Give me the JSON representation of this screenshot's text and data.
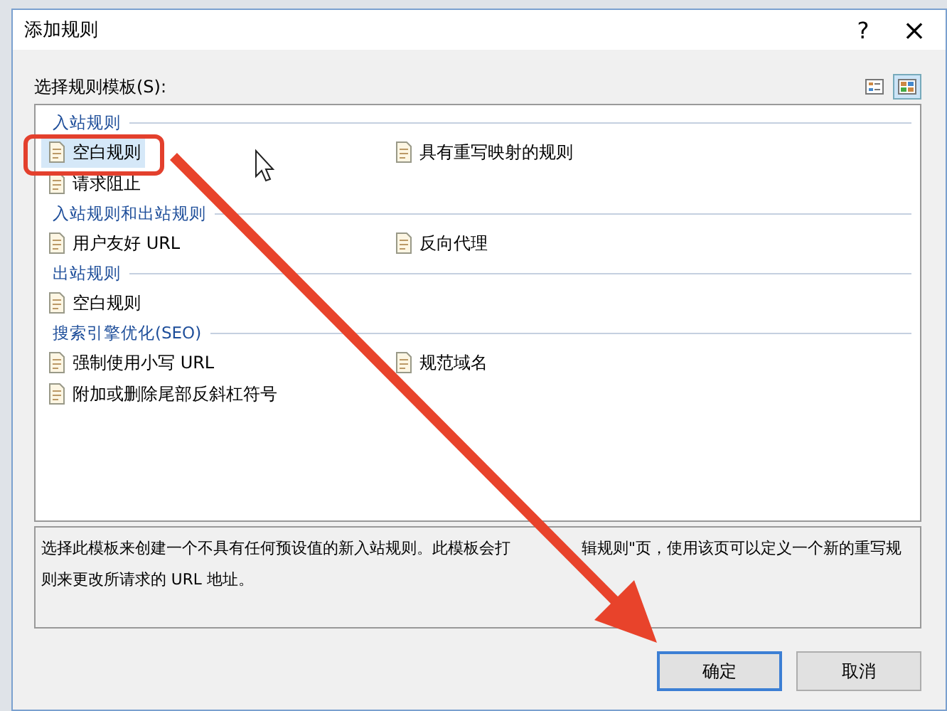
{
  "window": {
    "title": "添加规则",
    "help": "?",
    "close": "×"
  },
  "template_label": "选择规则模板(S):",
  "view_buttons": [
    {
      "selected": false
    },
    {
      "selected": true
    }
  ],
  "groups": [
    {
      "title": "入站规则",
      "items": [
        {
          "label": "空白规则",
          "selected": true
        },
        {
          "label": "具有重写映射的规则",
          "selected": false
        },
        {
          "label": "请求阻止",
          "selected": false
        }
      ]
    },
    {
      "title": "入站规则和出站规则",
      "items": [
        {
          "label": "用户友好 URL",
          "selected": false
        },
        {
          "label": "反向代理",
          "selected": false
        }
      ]
    },
    {
      "title": "出站规则",
      "items": [
        {
          "label": "空白规则",
          "selected": false
        }
      ]
    },
    {
      "title": "搜索引擎优化(SEO)",
      "items": [
        {
          "label": "强制使用小写 URL",
          "selected": false
        },
        {
          "label": "规范域名",
          "selected": false
        },
        {
          "label": "附加或删除尾部反斜杠符号",
          "selected": false
        }
      ]
    }
  ],
  "description": [
    "选择此模板来创建一个不具有任何预设值的新入站规则。此模板会打",
    "辑规则\"页，使用该页可以定义一个新的重写规",
    "则来更改所请求的 URL 地址。"
  ],
  "buttons": [
    {
      "label": "确定",
      "kind": "default"
    },
    {
      "label": "取消",
      "kind": "normal"
    }
  ],
  "annotations": [
    {
      "kind": "highlight"
    },
    {
      "kind": "arrow"
    },
    {
      "kind": "cursor"
    }
  ]
}
